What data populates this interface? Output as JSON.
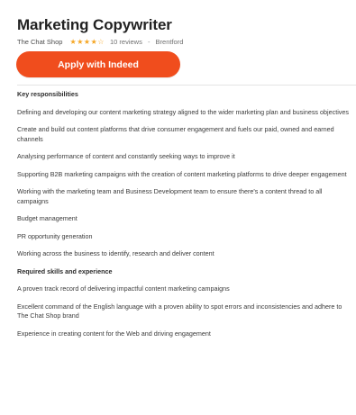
{
  "job": {
    "title": "Marketing Copywriter",
    "company": "The Chat Shop",
    "stars": "★★★★☆",
    "reviews": "10 reviews",
    "separator": "-",
    "location": "Brentford"
  },
  "apply_button": {
    "label": "Apply with Indeed"
  },
  "description": {
    "responsibilities_heading": "Key responsibilities",
    "responsibilities": [
      "Defining and developing our content marketing strategy aligned to the wider marketing plan and business objectives",
      "Create and build out content platforms that drive consumer engagement and fuels our paid, owned and earned channels",
      "Analysing performance of content and constantly seeking ways to improve it",
      "Supporting B2B marketing campaigns with the creation of content marketing platforms to drive deeper engagement",
      "Working with the marketing team and Business Development team to ensure there's a content thread to all campaigns",
      "Budget management",
      "PR opportunity generation",
      "Working across the business to identify, research and deliver content"
    ],
    "skills_heading": "Required skills and experience",
    "skills": [
      "A proven track record of delivering impactful content marketing campaigns",
      "Excellent command of the English language with a proven ability to spot errors and inconsistencies and adhere to The Chat Shop brand",
      "Experience in creating content for the Web and driving engagement"
    ]
  },
  "colors": {
    "apply_button_bg": "#f04d1d",
    "star_color": "#f5a623"
  }
}
